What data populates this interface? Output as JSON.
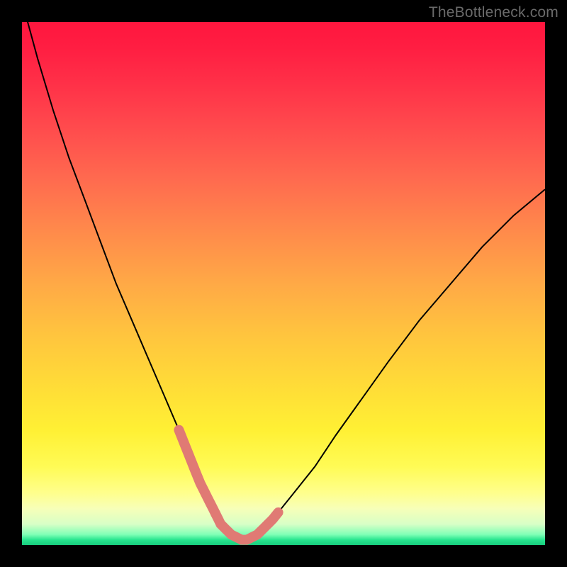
{
  "watermark": "TheBottleneck.com",
  "chart_data": {
    "type": "line",
    "title": "",
    "xlabel": "",
    "ylabel": "",
    "xlim": [
      0,
      100
    ],
    "ylim": [
      0,
      100
    ],
    "grid": false,
    "series": [
      {
        "name": "bottleneck-curve",
        "x": [
          0,
          3,
          6,
          9,
          12,
          15,
          18,
          21,
          24,
          27,
          30,
          32,
          34,
          36,
          37,
          38,
          40,
          42,
          43,
          45,
          48,
          52,
          56,
          60,
          65,
          70,
          76,
          82,
          88,
          94,
          100
        ],
        "y": [
          104,
          93,
          83,
          74,
          66,
          58,
          50,
          43,
          36,
          29,
          22,
          17,
          12,
          8,
          6,
          4,
          2,
          1,
          1,
          2,
          5,
          10,
          15,
          21,
          28,
          35,
          43,
          50,
          57,
          63,
          68
        ]
      }
    ],
    "highlight_ranges": [
      {
        "name": "left-descent-marker",
        "x_start": 30,
        "x_end": 37
      },
      {
        "name": "valley-floor-marker",
        "x_start": 37,
        "x_end": 43
      },
      {
        "name": "right-ascent-marker",
        "x_start": 43,
        "x_end": 49
      }
    ],
    "background_gradient": {
      "type": "vertical",
      "stops": [
        {
          "pos": 0.0,
          "color": "#ff163e"
        },
        {
          "pos": 0.5,
          "color": "#ffa946"
        },
        {
          "pos": 0.8,
          "color": "#fff538"
        },
        {
          "pos": 0.96,
          "color": "#d8ffc6"
        },
        {
          "pos": 1.0,
          "color": "#18cc7e"
        }
      ]
    }
  }
}
